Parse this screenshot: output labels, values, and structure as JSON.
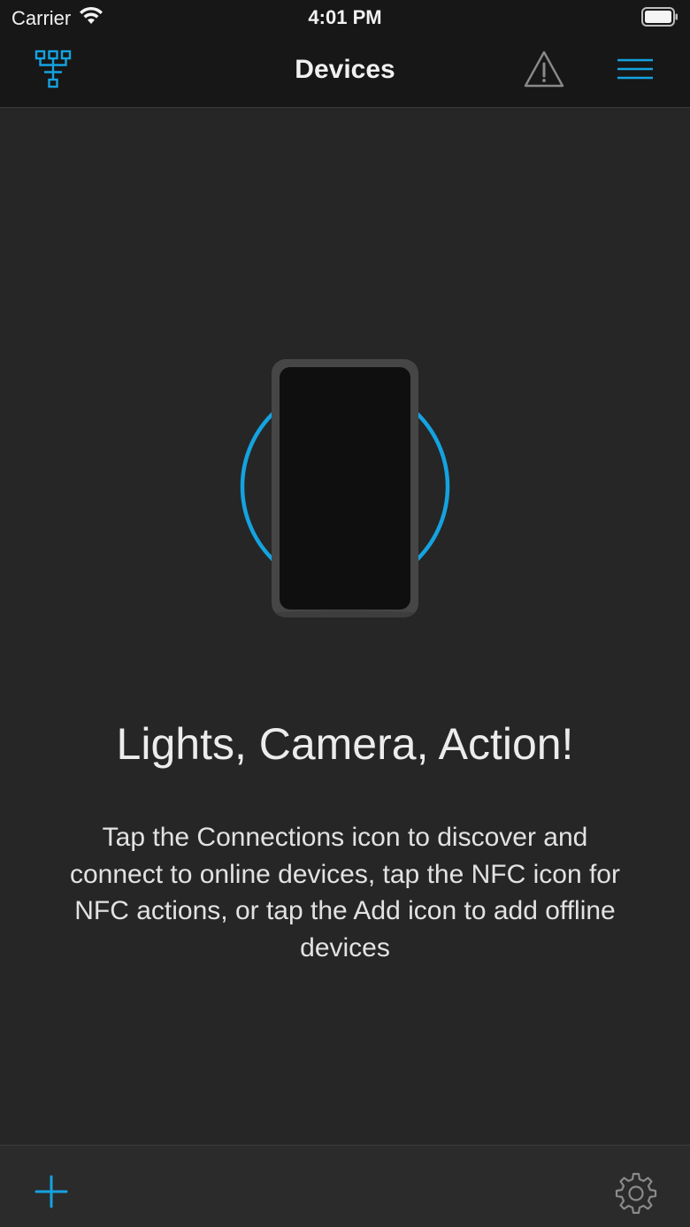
{
  "status_bar": {
    "carrier": "Carrier",
    "time": "4:01 PM"
  },
  "nav": {
    "title": "Devices",
    "left_icon": "connections-icon",
    "right_icons": [
      "alert-triangle-icon",
      "hamburger-menu-icon"
    ]
  },
  "empty_state": {
    "illustration": "phone-nfc-illustration",
    "headline": "Lights, Camera, Action!",
    "description": "Tap the Connections icon to discover and connect to online devices, tap the NFC icon for NFC actions, or tap the Add icon to add offline devices"
  },
  "toolbar": {
    "left_icon": "plus-icon",
    "right_icon": "gear-icon"
  },
  "colors": {
    "accent": "#14a3e0",
    "background": "#262626",
    "bar": "#171717",
    "text": "#e6e6e6",
    "icon_gray": "#8a8a8a"
  }
}
